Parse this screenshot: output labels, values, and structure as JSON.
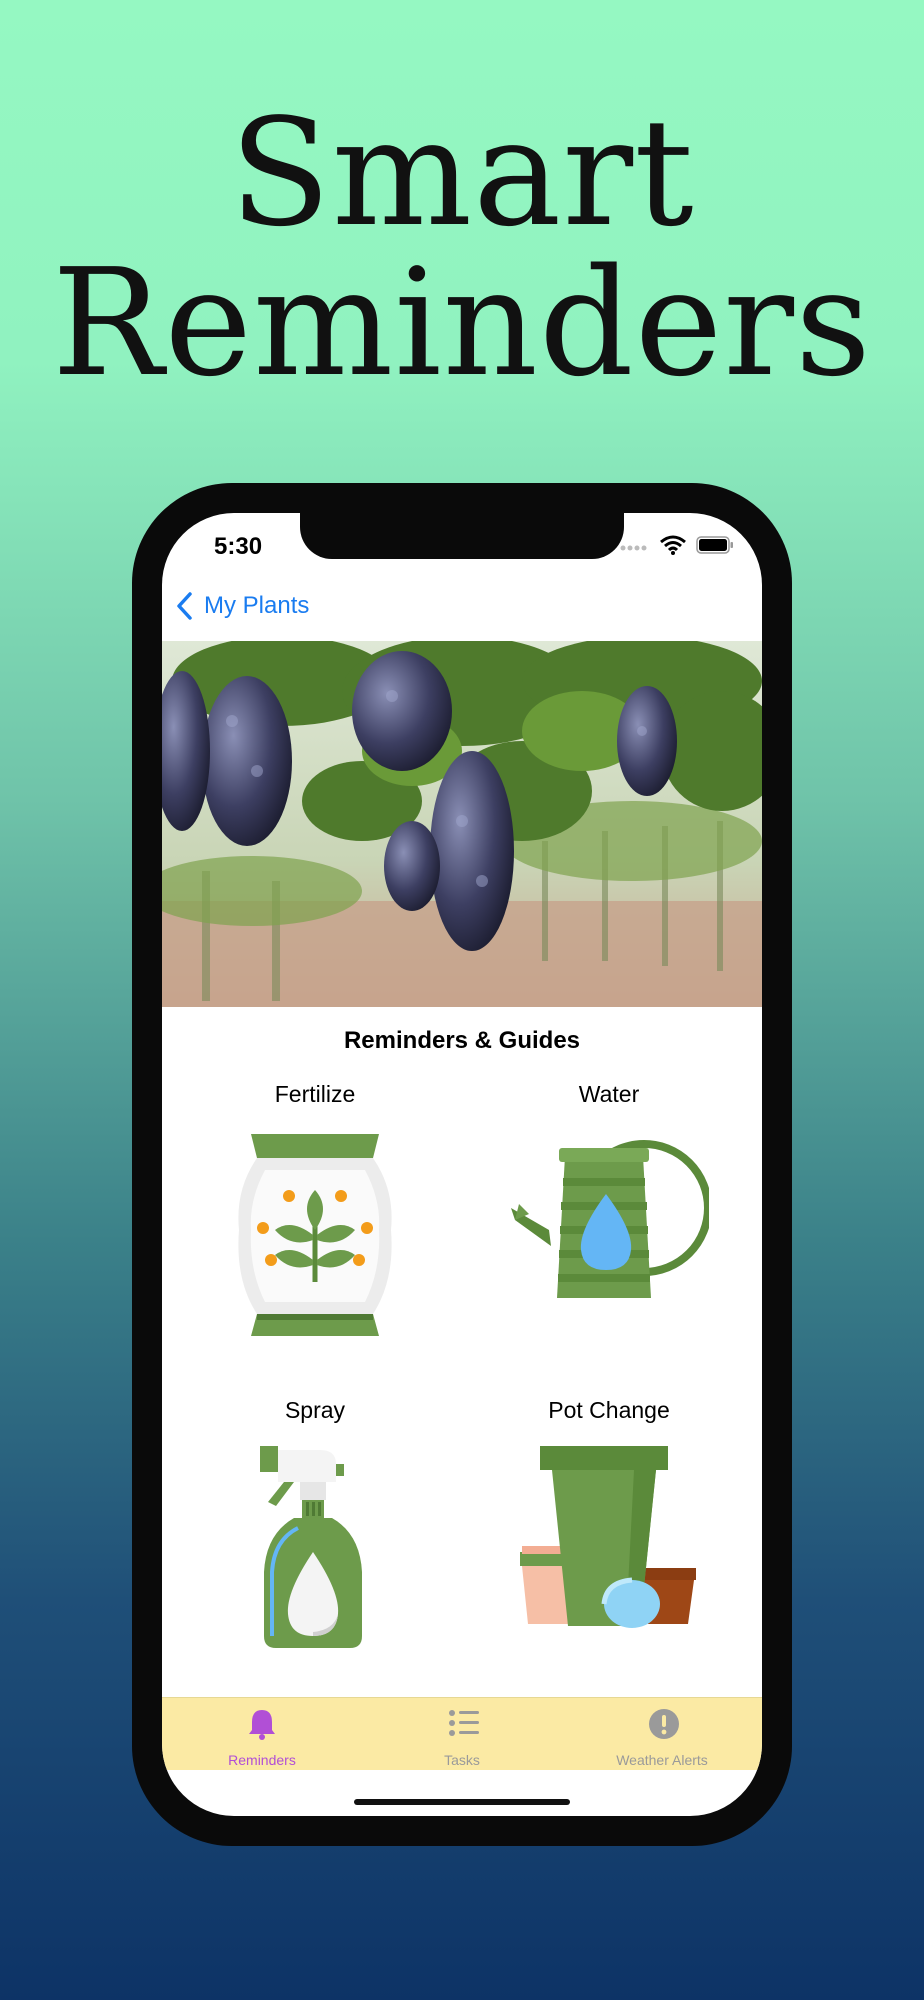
{
  "headline": {
    "line1": "Smart",
    "line2": "Reminders"
  },
  "status_bar": {
    "time": "5:30"
  },
  "nav": {
    "back_label": "My Plants"
  },
  "section": {
    "title": "Reminders & Guides"
  },
  "cards": [
    {
      "label": "Fertilize",
      "icon": "fertilizer-bag-icon"
    },
    {
      "label": "Water",
      "icon": "watering-can-icon"
    },
    {
      "label": "Spray",
      "icon": "spray-bottle-icon"
    },
    {
      "label": "Pot Change",
      "icon": "flower-pots-icon"
    }
  ],
  "tabs": [
    {
      "label": "Reminders",
      "icon": "bell-icon",
      "active": true
    },
    {
      "label": "Tasks",
      "icon": "list-icon",
      "active": false
    },
    {
      "label": "Weather Alerts",
      "icon": "exclamation-icon",
      "active": false
    }
  ],
  "colors": {
    "accent_blue": "#1a7cf0",
    "tab_active": "#b14fd6",
    "tab_inactive": "#9a9a9a",
    "tab_bar": "#fbeaa4",
    "plant_green": "#6d9b4b"
  }
}
